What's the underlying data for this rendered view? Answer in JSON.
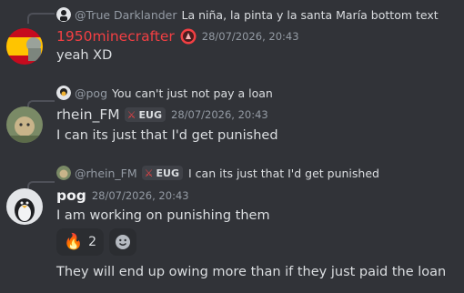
{
  "messages": [
    {
      "reply": {
        "name": "@True Darklander",
        "text": "La niña, la pinta y la santa María   bottom text"
      },
      "author": {
        "name": "1950minecrafter",
        "color": "#f23f43"
      },
      "timestamp": "28/07/2026, 20:43",
      "text": "yeah XD"
    },
    {
      "reply": {
        "name": "@pog",
        "text": "You can't just not pay a loan"
      },
      "author": {
        "name": "rhein_FM",
        "color": "#dbdee1",
        "tag": "EUG"
      },
      "timestamp": "28/07/2026, 20:43",
      "text": "I can its just that I'd get punished"
    },
    {
      "reply": {
        "name": "@rhein_FM",
        "tag": "EUG",
        "text": "I can its just that I'd get punished"
      },
      "author": {
        "name": "pog",
        "color": "#f2f3f5"
      },
      "timestamp": "28/07/2026, 20:43",
      "text": "I am working on punishing them",
      "reactions": [
        {
          "emoji": "fire-icon",
          "count": "2"
        }
      ],
      "followup": "They will end up owing more than if they just paid the loan"
    }
  ]
}
